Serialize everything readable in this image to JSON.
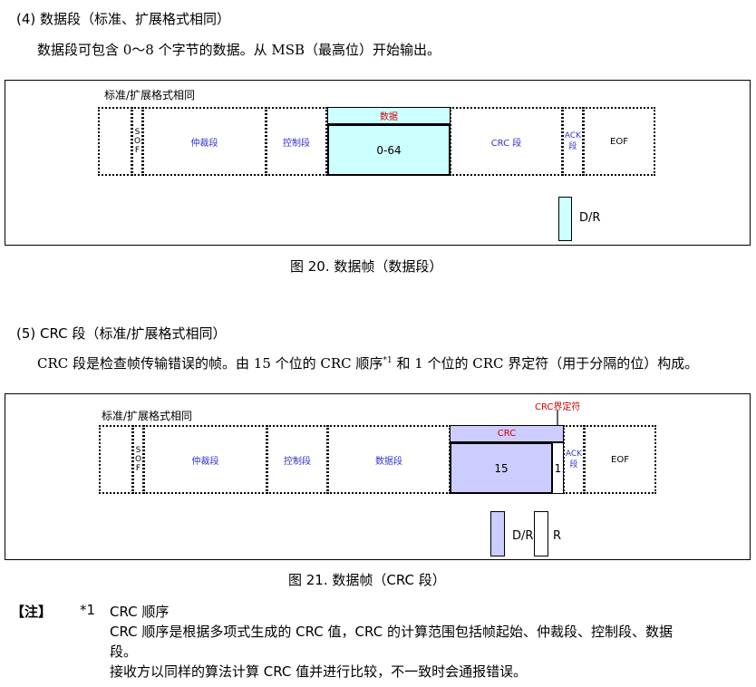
{
  "sec4": {
    "heading": "(4)  数据段（标准、扩展格式相同）",
    "text": "数据段可包含 0～8 个字节的数据。从 MSB（最高位）开始输出。"
  },
  "fig20": {
    "box_title": "标准/扩展格式相同",
    "sof_letters": [
      "S",
      "O",
      "F"
    ],
    "arb": "仲裁段",
    "ctrl": "控制段",
    "data_top": "数据",
    "data_main": "0-64",
    "crc": "CRC 段",
    "ack_letters": [
      "ACK",
      "段"
    ],
    "eof": "EOF",
    "dr": "D/R",
    "caption": "图 20.   数据帧（数据段）",
    "colors": {
      "data_fill": "#ccffff",
      "data_label": "#d00000"
    }
  },
  "sec5": {
    "heading": "(5)  CRC 段（标准/扩展格式相同）",
    "text_a": "CRC 段是检查帧传输错误的帧。由 15 个位的 CRC 顺序",
    "sup": "*1",
    "text_b": " 和 1 个位的 CRC 界定符（用于分隔的位）构成。"
  },
  "fig21": {
    "box_title": "标准/扩展格式相同",
    "delim_label": "CRC界定符",
    "sof_letters": [
      "S",
      "O",
      "F"
    ],
    "arb": "仲裁段",
    "ctrl": "控制段",
    "data": "数据段",
    "crc_top": "CRC",
    "crc_main": "15",
    "crc_one": "1",
    "ack_letters": [
      "ACK",
      "段"
    ],
    "eof": "EOF",
    "dr": "D/R",
    "r": "R",
    "caption": "图 21.   数据帧（CRC 段）",
    "colors": {
      "crc_fill": "#ccccff",
      "crc_label": "#d00000"
    }
  },
  "note": {
    "tag": "【注】",
    "num": "*1",
    "title": "CRC 顺序",
    "line1": "CRC 顺序是根据多项式生成的 CRC 值，CRC 的计算范围包括帧起始、仲裁段、控制段、数据",
    "line2": "段。",
    "line3": "接收方以同样的算法计算 CRC 值并进行比较，不一致时会通报错误。"
  }
}
